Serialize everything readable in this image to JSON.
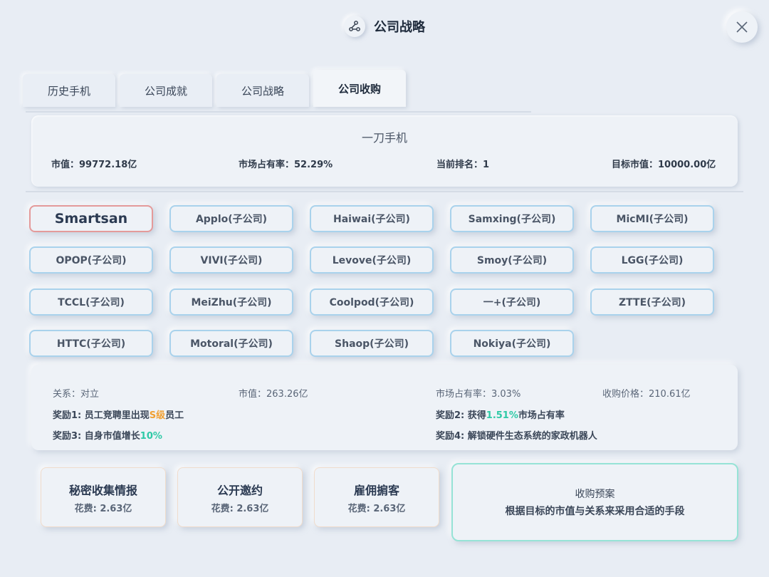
{
  "header": {
    "title": "公司战略",
    "icon": "network-icon",
    "close_icon": "close-icon"
  },
  "tabs": [
    {
      "label": "历史手机",
      "active": false
    },
    {
      "label": "公司成就",
      "active": false
    },
    {
      "label": "公司战略",
      "active": false
    },
    {
      "label": "公司收购",
      "active": true
    }
  ],
  "company": {
    "name": "一刀手机",
    "market_value": "市值：99772.18亿",
    "market_share": "市场占有率：52.29%",
    "rank": "当前排名：1",
    "target_value": "目标市值：10000.00亿"
  },
  "companies": [
    {
      "label": "Smartsan",
      "selected": true
    },
    {
      "label": "Applo(子公司)"
    },
    {
      "label": "Haiwai(子公司)"
    },
    {
      "label": "Samxing(子公司)"
    },
    {
      "label": "MicMI(子公司)"
    },
    {
      "label": "OPOP(子公司)"
    },
    {
      "label": "VIVI(子公司)"
    },
    {
      "label": "Levove(子公司)"
    },
    {
      "label": "Smoy(子公司)"
    },
    {
      "label": "LGG(子公司)"
    },
    {
      "label": "TCCL(子公司)"
    },
    {
      "label": "MeiZhu(子公司)"
    },
    {
      "label": "Coolpod(子公司)"
    },
    {
      "label": "一+(子公司)"
    },
    {
      "label": "ZTTE(子公司)"
    },
    {
      "label": "HTTC(子公司)"
    },
    {
      "label": "Motoral(子公司)"
    },
    {
      "label": "Shaop(子公司)"
    },
    {
      "label": "Nokiya(子公司)"
    }
  ],
  "detail": {
    "relation": "关系：对立",
    "market_value": "市值：263.26亿",
    "market_share": "市场占有率：3.03%",
    "price": "收购价格：210.61亿",
    "reward1_prefix": "奖励1: 员工竞聘里出现",
    "reward1_highlight": "S级",
    "reward1_suffix": "员工",
    "reward2_prefix": "奖励2: 获得",
    "reward2_highlight": "1.51%",
    "reward2_suffix": "市场占有率",
    "reward3_prefix": "奖励3: 自身市值增长",
    "reward3_highlight": "10%",
    "reward4": "奖励4: 解锁硬件生态系统的家政机器人"
  },
  "actions": [
    {
      "title": "秘密收集情报",
      "cost": "花费: 2.63亿"
    },
    {
      "title": "公开邀约",
      "cost": "花费: 2.63亿"
    },
    {
      "title": "雇佣掮客",
      "cost": "花费: 2.63亿"
    }
  ],
  "plan": {
    "title": "收购预案",
    "desc": "根据目标的市值与关系来采用合适的手段"
  },
  "colors": {
    "background": "#e8edf4",
    "selected_border": "#e49a9a",
    "company_border": "#a9d2ec",
    "highlight_orange": "#f0a033",
    "highlight_teal": "#2ec9a6",
    "plan_border": "#96e3d6"
  }
}
